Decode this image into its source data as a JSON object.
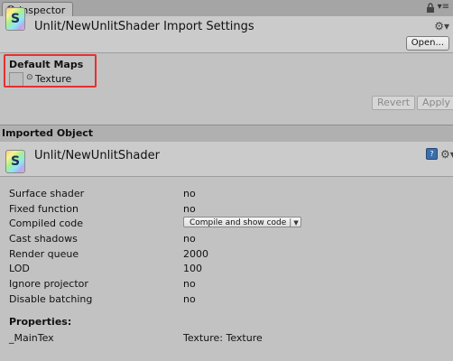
{
  "tab": {
    "label": "Inspector",
    "icon": "info-icon",
    "menu_glyph": "▾≡"
  },
  "header": {
    "title": "Unlit/NewUnlitShader Import Settings",
    "icon_letter": "S",
    "open_label": "Open..."
  },
  "default_maps": {
    "title": "Default Maps",
    "texture_label": "Texture",
    "dot": "⊙"
  },
  "buttons": {
    "revert": "Revert",
    "apply": "Apply"
  },
  "imported_object": {
    "section_title": "Imported Object",
    "name": "Unlit/NewUnlitShader",
    "icon_letter": "S",
    "help_glyph": "?"
  },
  "properties": [
    {
      "label": "Surface shader",
      "value": "no"
    },
    {
      "label": "Fixed function",
      "value": "no"
    },
    {
      "label": "Compiled code",
      "value": "Compile and show code"
    },
    {
      "label": "Cast shadows",
      "value": "no"
    },
    {
      "label": "Render queue",
      "value": "2000"
    },
    {
      "label": "LOD",
      "value": "100"
    },
    {
      "label": "Ignore projector",
      "value": "no"
    },
    {
      "label": "Disable batching",
      "value": "no"
    }
  ],
  "shader_properties": {
    "title": "Properties:",
    "items": [
      {
        "name": "_MainTex",
        "value": "Texture: Texture"
      }
    ]
  },
  "colors": {
    "highlight": "#e53030",
    "background": "#c2c2c2"
  }
}
